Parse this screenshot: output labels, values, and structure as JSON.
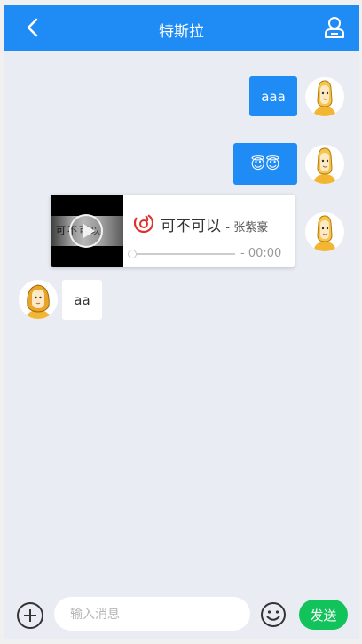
{
  "header": {
    "title": "特斯拉"
  },
  "messages": [
    {
      "side": "me",
      "text": "aaa"
    },
    {
      "side": "me",
      "emoji": "😇😇"
    },
    {
      "side": "me",
      "music": {
        "title": "可不可以",
        "artist": "- 张紫豪",
        "time": "- 00:00",
        "cover_text": "可不可以",
        "progress": 0
      }
    },
    {
      "side": "other",
      "text": "aa"
    }
  ],
  "input": {
    "placeholder": "输入消息",
    "send_label": "发送"
  },
  "colors": {
    "header": "#1f8cf5",
    "bubble_me": "#1f8cf5",
    "send": "#12c25b",
    "background": "#e9ecf3"
  }
}
